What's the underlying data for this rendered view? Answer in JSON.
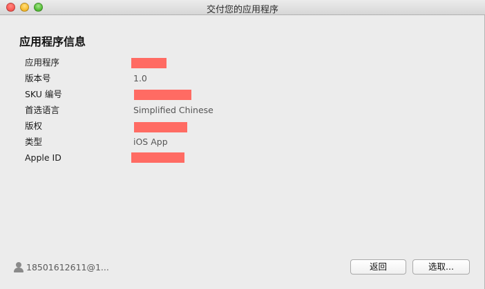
{
  "window": {
    "title": "交付您的应用程序"
  },
  "section": {
    "title": "应用程序信息"
  },
  "info_rows": [
    {
      "label": "应用程序",
      "value": null,
      "redacted": true
    },
    {
      "label": "版本号",
      "value": "1.0",
      "redacted": false
    },
    {
      "label": "SKU 编号",
      "value": null,
      "redacted": true
    },
    {
      "label": "首选语言",
      "value": "Simplified Chinese",
      "redacted": false
    },
    {
      "label": "版权",
      "value": null,
      "redacted": true
    },
    {
      "label": "类型",
      "value": "iOS App",
      "redacted": false
    },
    {
      "label": "Apple ID",
      "value": null,
      "redacted": true
    }
  ],
  "footer": {
    "account": "18501612611@1...",
    "back_label": "返回",
    "choose_label": "选取..."
  },
  "colors": {
    "redaction": "#ff6b63",
    "background": "#ececec"
  },
  "icons": {
    "user": "user-icon"
  }
}
